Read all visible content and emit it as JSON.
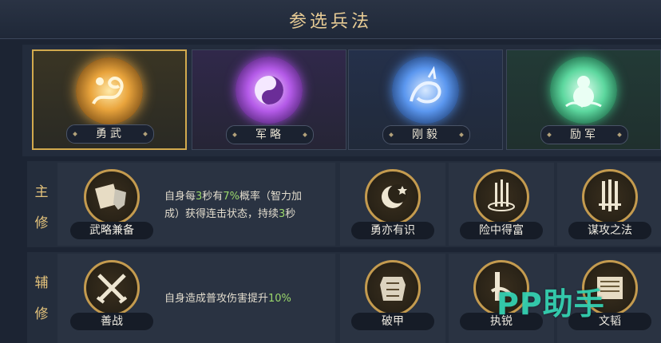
{
  "title": "参选兵法",
  "categories": [
    {
      "label": "勇武",
      "selected": true,
      "color": "#e9b552",
      "icon": "dragon-icon"
    },
    {
      "label": "军略",
      "selected": false,
      "color": "#b45ae8",
      "icon": "yin-yang-icon"
    },
    {
      "label": "刚毅",
      "selected": false,
      "color": "#5b97ef",
      "icon": "qilin-icon"
    },
    {
      "label": "励军",
      "selected": false,
      "color": "#5cd79e",
      "icon": "gourd-cloud-icon"
    }
  ],
  "main": {
    "label_1": "主",
    "label_2": "修",
    "selected_skill": "武略兼备",
    "desc_a": "自身每",
    "desc_b": "3",
    "desc_c": "秒有",
    "desc_d": "7%",
    "desc_e": "概率（智力加",
    "desc_f": "成）获得连击状态，持续",
    "desc_g": "3",
    "desc_h": "秒",
    "skills": [
      "勇亦有识",
      "险中得富",
      "谋攻之法"
    ]
  },
  "aux": {
    "label_1": "辅",
    "label_2": "修",
    "selected_skill": "善战",
    "desc_a": "自身造成普攻伤害提升",
    "desc_b": "10%",
    "skills": [
      "破甲",
      "执锐",
      "文韬"
    ]
  },
  "watermark": "PP助手",
  "colors": {
    "gold": "#c49b4f",
    "highlight": "#9bd86c",
    "title": "#e8cc95"
  }
}
